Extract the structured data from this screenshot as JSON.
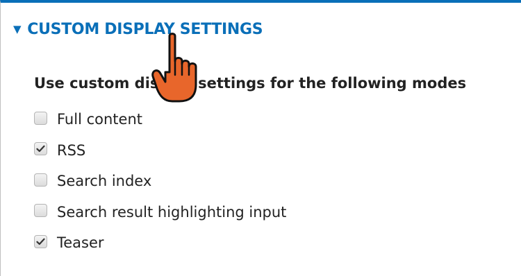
{
  "details": {
    "summary_icon": "triangle-down-icon",
    "summary_title": "CUSTOM DISPLAY SETTINGS",
    "legend": "Use custom display settings for the following modes",
    "options": [
      {
        "label": "Full content",
        "checked": false
      },
      {
        "label": "RSS",
        "checked": true
      },
      {
        "label": "Search index",
        "checked": false
      },
      {
        "label": "Search result highlighting input",
        "checked": false
      },
      {
        "label": "Teaser",
        "checked": true
      }
    ]
  },
  "cursor": {
    "icon": "hand-pointer-icon"
  },
  "colors": {
    "accent": "#0a6fb8",
    "text": "#222222",
    "cursor_fill": "#e8662b"
  }
}
